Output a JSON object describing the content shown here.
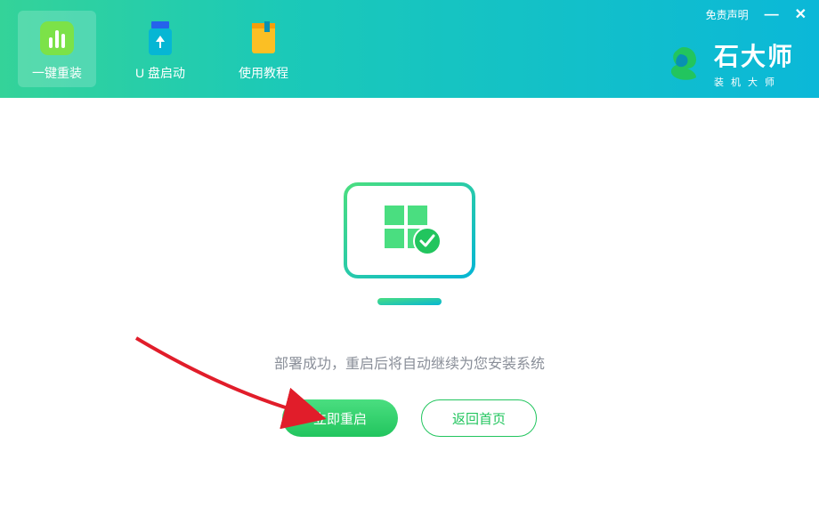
{
  "window": {
    "disclaimer": "免责声明",
    "minimize": "—",
    "close": "✕"
  },
  "brand": {
    "title": "石大师",
    "subtitle": "装机大师"
  },
  "tabs": [
    {
      "id": "reinstall",
      "label": "一键重装",
      "active": true
    },
    {
      "id": "usb-boot",
      "label": "U 盘启动",
      "active": false
    },
    {
      "id": "tutorial",
      "label": "使用教程",
      "active": false
    }
  ],
  "main": {
    "status_text": "部署成功，重启后将自动继续为您安装系统",
    "primary_button": "立即重启",
    "secondary_button": "返回首页"
  },
  "colors": {
    "accent_green": "#22c55e",
    "header_grad_start": "#34d399",
    "header_grad_end": "#0bb8d8"
  }
}
